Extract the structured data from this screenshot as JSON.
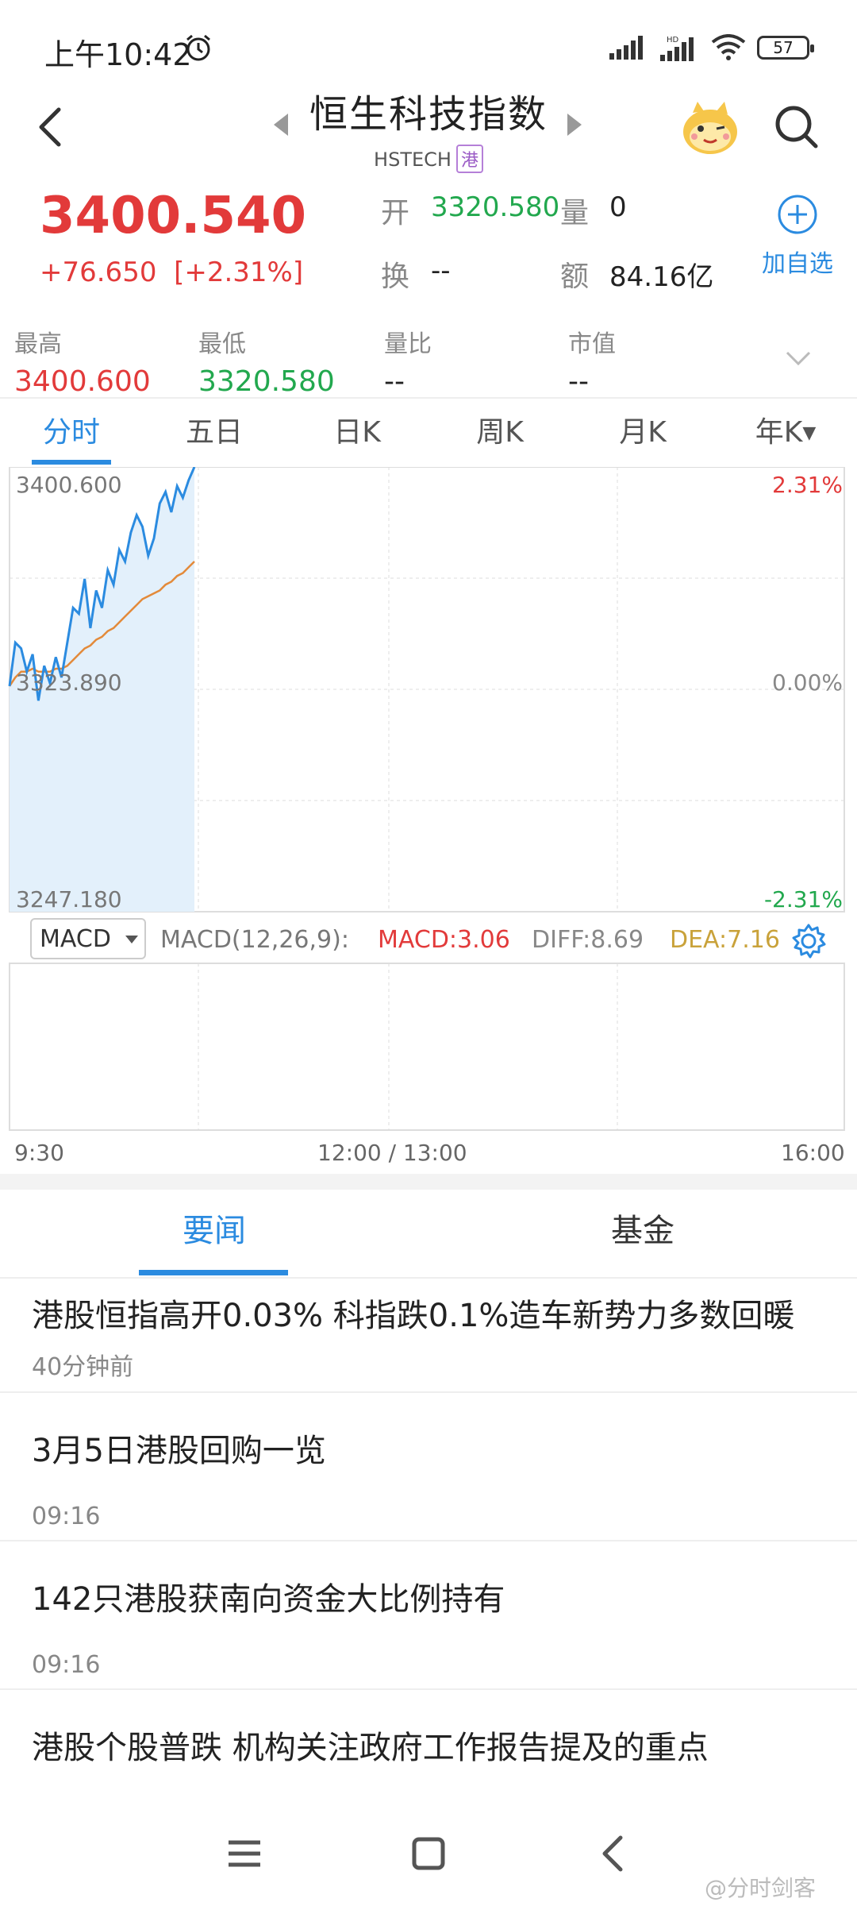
{
  "status": {
    "time": "上午10:42",
    "battery": "57"
  },
  "header": {
    "title": "恒生科技指数",
    "code": "HSTECH",
    "market_tag": "港"
  },
  "quote": {
    "price": "3400.540",
    "change": "+76.650",
    "change_pct": "[+2.31%]",
    "open_label": "开",
    "open_value": "3320.580",
    "volume_label": "量",
    "volume_value": "0",
    "turnover_label": "换",
    "turnover_value": "--",
    "amount_label": "额",
    "amount_value": "84.16亿",
    "add_watch_label": "加自选"
  },
  "stats": [
    {
      "label": "最高",
      "value": "3400.600"
    },
    {
      "label": "最低",
      "value": "3320.580"
    },
    {
      "label": "量比",
      "value": "--"
    },
    {
      "label": "市值",
      "value": "--"
    }
  ],
  "tabs": [
    "分时",
    "五日",
    "日K",
    "周K",
    "月K",
    "年K"
  ],
  "chart": {
    "y_top": "3400.600",
    "y_mid": "3323.890",
    "y_bottom": "3247.180",
    "pct_top": "2.31%",
    "pct_mid": "0.00%",
    "pct_bottom": "-2.31%",
    "macd_select": "MACD",
    "macd_params": "MACD(12,26,9):",
    "macd_value": "MACD:3.06",
    "diff_value": "DIFF:8.69",
    "dea_value": "DEA:7.16",
    "time_start": "9:30",
    "time_mid": "12:00 / 13:00",
    "time_end": "16:00",
    "colors": {
      "price_line": "#2b8be0",
      "avg_line": "#e38a3a",
      "fill": "#e3f0fb"
    }
  },
  "chart_data": {
    "type": "line",
    "ylim": [
      3247.18,
      3400.6
    ],
    "series": [
      {
        "values": [
          3325,
          3340,
          3338,
          3330,
          3336,
          3320,
          3332,
          3326,
          3335,
          3328,
          3340,
          3352,
          3350,
          3362,
          3345,
          3358,
          3352,
          3365,
          3360,
          3372,
          3368,
          3378,
          3384,
          3380,
          3370,
          3376,
          3388,
          3392,
          3385,
          3394,
          3390,
          3396,
          3400.6
        ]
      },
      {
        "values": [
          3325,
          3328,
          3330,
          3330,
          3331,
          3330,
          3330,
          3330,
          3331,
          3331,
          3332,
          3334,
          3336,
          3338,
          3339,
          3341,
          3342,
          3344,
          3345,
          3347,
          3349,
          3351,
          3353,
          3355,
          3356,
          3357,
          3358,
          3360,
          3361,
          3363,
          3364,
          3366,
          3368
        ]
      }
    ]
  },
  "news_tabs": [
    "要闻",
    "基金"
  ],
  "news": [
    {
      "title": "港股恒指高开0.03% 科指跌0.1%造车新势力多数回暖",
      "time": "40分钟前"
    },
    {
      "title": "3月5日港股回购一览",
      "time": "09:16"
    },
    {
      "title": "142只港股获南向资金大比例持有",
      "time": "09:16"
    },
    {
      "title": "港股个股普跌 机构关注政府工作报告提及的重点",
      "time": ""
    }
  ],
  "watermark": "@分时剑客"
}
